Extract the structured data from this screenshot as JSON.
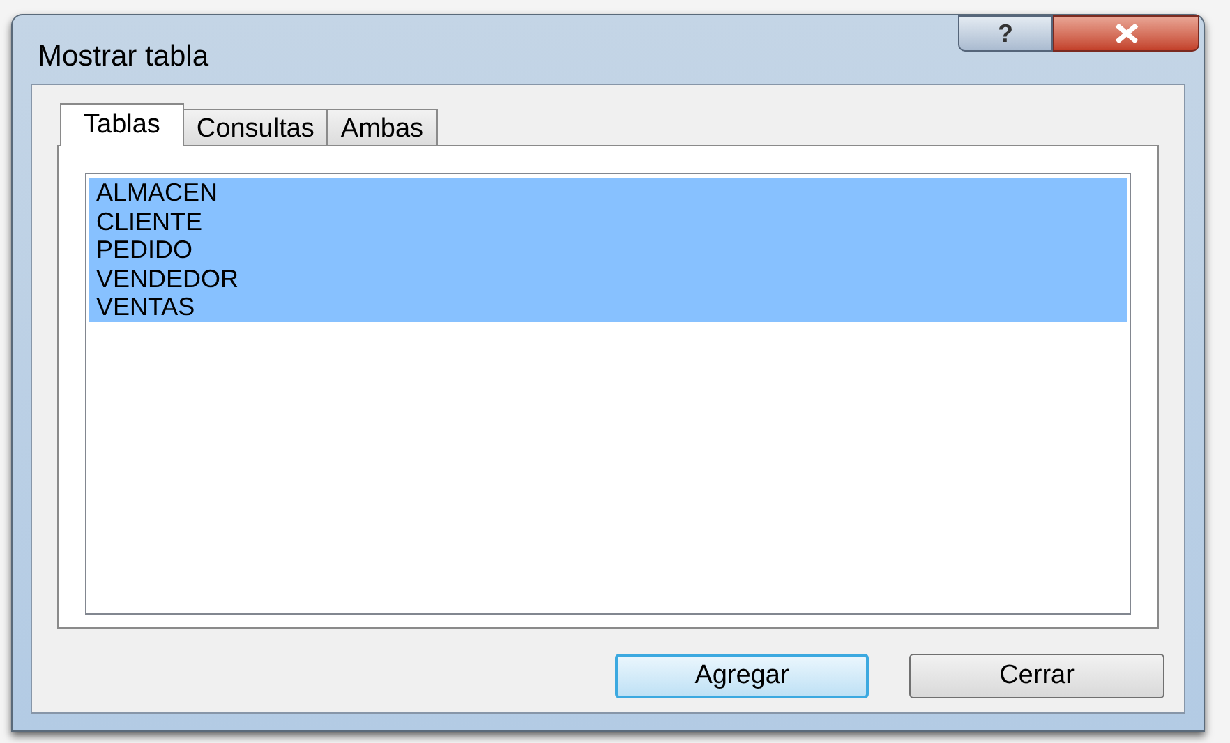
{
  "window": {
    "title": "Mostrar tabla",
    "help_button": "?"
  },
  "tabs": [
    {
      "label": "Tablas",
      "selected": true
    },
    {
      "label": "Consultas",
      "selected": false
    },
    {
      "label": "Ambas",
      "selected": false
    }
  ],
  "list": [
    {
      "label": "ALMACEN",
      "selected": true
    },
    {
      "label": "CLIENTE",
      "selected": true
    },
    {
      "label": "PEDIDO",
      "selected": true
    },
    {
      "label": "VENDEDOR",
      "selected": true
    },
    {
      "label": "VENTAS",
      "selected": true
    }
  ],
  "buttons": [
    {
      "label": "Agregar",
      "default": true
    },
    {
      "label": "Cerrar",
      "default": false
    }
  ]
}
